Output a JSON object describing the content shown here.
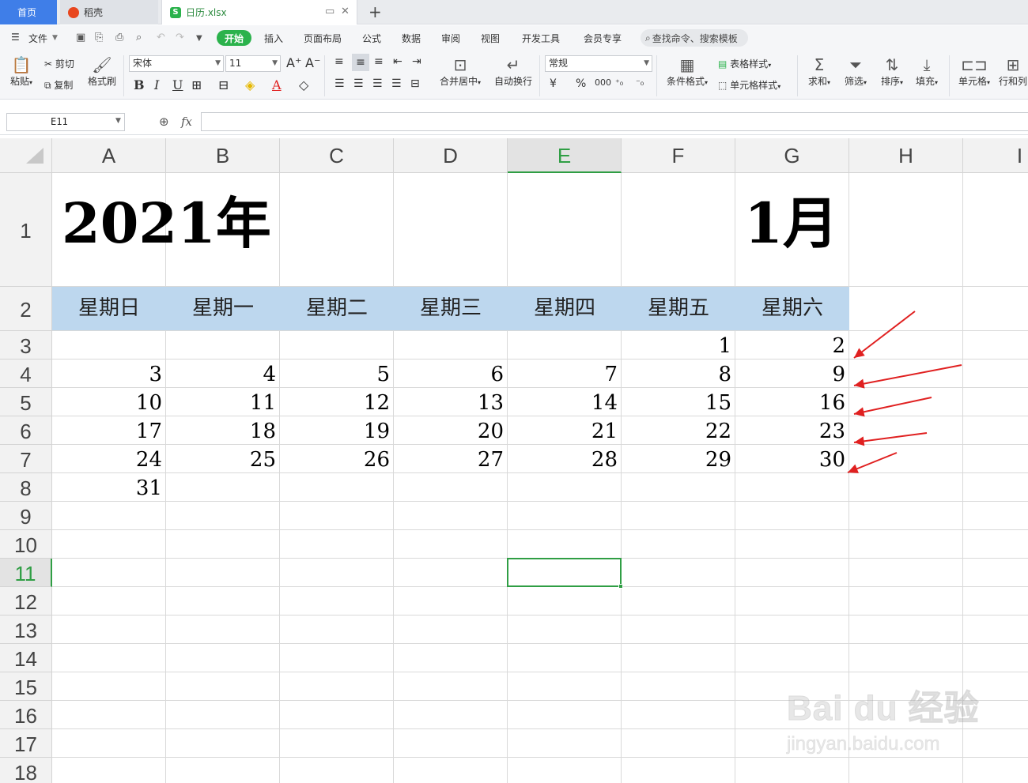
{
  "tabs": {
    "home": "首页",
    "daoke": "稻壳",
    "file": "日历.xlsx",
    "file_icon": "S"
  },
  "menu": {
    "file": "文件",
    "start": "开始",
    "items": [
      "插入",
      "页面布局",
      "公式",
      "数据",
      "审阅",
      "视图",
      "开发工具",
      "会员专享"
    ],
    "search": "查找命令、搜索模板"
  },
  "ribbon": {
    "paste": "粘贴",
    "cut": "剪切",
    "copy": "复制",
    "format_painter": "格式刷",
    "font_name": "宋体",
    "font_size": "11",
    "merge_center": "合并居中",
    "wrap_text": "自动换行",
    "number_format": "常规",
    "conditional_format": "条件格式",
    "table_style": "表格样式",
    "cell_style": "单元格样式",
    "sum": "求和",
    "filter": "筛选",
    "sort": "排序",
    "fill": "填充",
    "cell": "单元格",
    "row_col": "行和列",
    "currency": "¥",
    "percent": "%",
    "thousands": "000"
  },
  "formula_bar": {
    "cell_ref": "E11",
    "fx": "fx",
    "value": ""
  },
  "sheet": {
    "columns": [
      "A",
      "B",
      "C",
      "D",
      "E",
      "F",
      "G",
      "H",
      "I"
    ],
    "rows": [
      "1",
      "2",
      "3",
      "4",
      "5",
      "6",
      "7",
      "8",
      "9",
      "10",
      "11",
      "12",
      "13",
      "14",
      "15",
      "16",
      "17",
      "18"
    ],
    "active_column": "E",
    "active_row": "11",
    "year_title": "2021年",
    "month_title": "1月",
    "weekdays": [
      "星期日",
      "星期一",
      "星期二",
      "星期三",
      "星期四",
      "星期五",
      "星期六"
    ],
    "weekday_band_color": "#bdd7ee",
    "calendar_weeks": [
      [
        "",
        "",
        "",
        "",
        "",
        "1",
        "2"
      ],
      [
        "3",
        "4",
        "5",
        "6",
        "7",
        "8",
        "9"
      ],
      [
        "10",
        "11",
        "12",
        "13",
        "14",
        "15",
        "16"
      ],
      [
        "17",
        "18",
        "19",
        "20",
        "21",
        "22",
        "23"
      ],
      [
        "24",
        "25",
        "26",
        "27",
        "28",
        "29",
        "30"
      ],
      [
        "31",
        "",
        "",
        "",
        "",
        "",
        ""
      ]
    ],
    "annotation_color": "#e02020"
  },
  "watermark": {
    "brand": "Bai du 经验",
    "url": "jingyan.baidu.com"
  },
  "accent_color": "#2bb24c"
}
